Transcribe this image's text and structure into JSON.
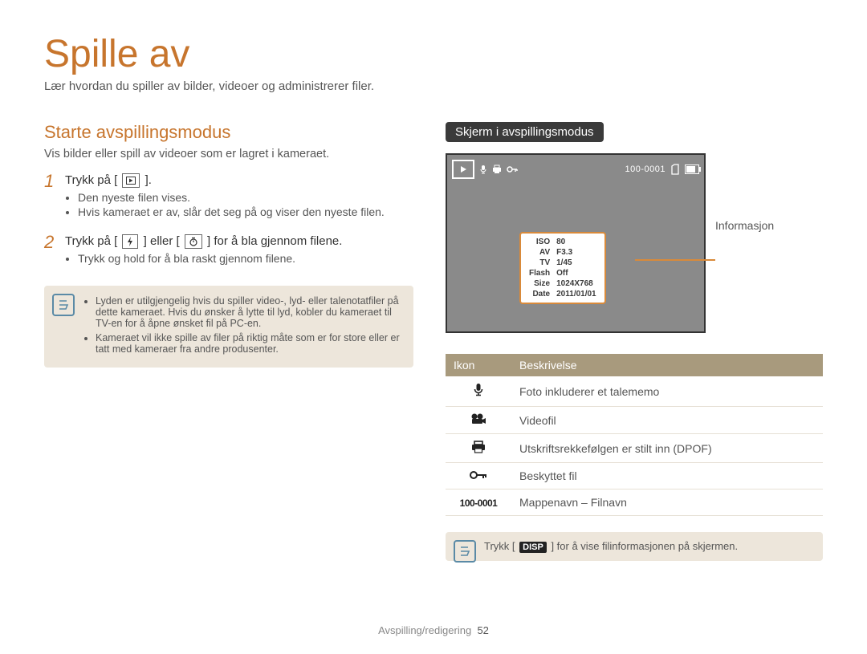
{
  "page": {
    "title": "Spille av",
    "subtitle": "Lær hvordan du spiller av bilder, videoer og administrerer filer."
  },
  "left": {
    "heading": "Starte avspillingsmodus",
    "lead": "Vis bilder eller spill av videoer som er lagret i kameraet.",
    "step1_num": "1",
    "step1_a": "Trykk på [",
    "step1_b": "].",
    "step1_bullets": [
      "Den nyeste filen vises.",
      "Hvis kameraet er av, slår det seg på og viser den nyeste filen."
    ],
    "step2_num": "2",
    "step2_a": "Trykk på [",
    "step2_mid": "] eller [",
    "step2_b": "] for å bla gjennom filene.",
    "step2_bullets": [
      "Trykk og hold for å bla raskt gjennom filene."
    ],
    "note_items": [
      "Lyden er utilgjengelig hvis du spiller video-, lyd- eller talenotatfiler på dette kameraet. Hvis du ønsker å lytte til lyd, kobler du kameraet til TV-en for å åpne ønsket fil på PC-en.",
      "Kameraet vil ikke spille av filer på riktig måte som er for store eller er tatt med kameraer fra andre produsenter."
    ]
  },
  "right": {
    "black_label": "Skjerm i avspillingsmodus",
    "topbar_folder_file": "100-0001",
    "info_rows": [
      [
        "ISO",
        "80"
      ],
      [
        "AV",
        "F3.3"
      ],
      [
        "TV",
        "1/45"
      ],
      [
        "Flash",
        "Off"
      ],
      [
        "Size",
        "1024X768"
      ],
      [
        "Date",
        "2011/01/01"
      ]
    ],
    "callout_label": "Informasjon",
    "table_headers": {
      "icon": "Ikon",
      "desc": "Beskrivelse"
    },
    "table_rows": [
      {
        "desc": "Foto inkluderer et talememo"
      },
      {
        "desc": "Videofil"
      },
      {
        "desc": "Utskriftsrekkefølgen er stilt inn (DPOF)"
      },
      {
        "desc": "Beskyttet fil"
      },
      {
        "label": "100-0001",
        "desc": "Mappenavn – Filnavn"
      }
    ],
    "note_a": "Trykk [",
    "note_disp": "DISP",
    "note_b": "] for å vise filinformasjonen på skjermen."
  },
  "footer": {
    "section": "Avspilling/redigering",
    "page_num": "52"
  }
}
